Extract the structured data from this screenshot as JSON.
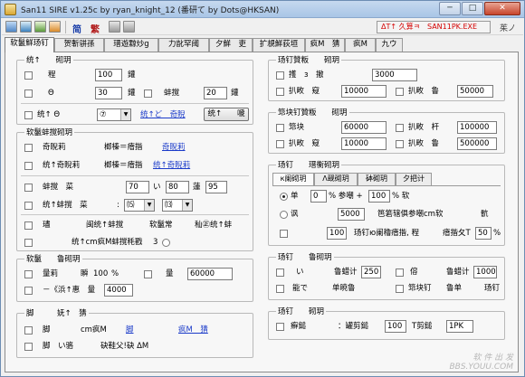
{
  "window": {
    "title": "San11 SIRE v1.25c by ryan_knight_12 (番研て by Dots@HKSAN)",
    "min_label": "─",
    "max_label": "□",
    "close_label": "✕"
  },
  "toolbar": {
    "simplified_label": "简",
    "traditional_label": "繁",
    "status_prefix": "ΔT↑ 久算ㅋ",
    "process_name": "SAN11PK.EXE",
    "language_label": "茱ノ"
  },
  "tabs": [
    {
      "label": "软鬣鮮玚钉",
      "active": true
    },
    {
      "label": "贺斬骈孫"
    },
    {
      "label": "瑨遊黥炒g"
    },
    {
      "label": "力龀罕阈"
    },
    {
      "label": "夕鮮　吏"
    },
    {
      "label": "扩覟鮮荻垣"
    },
    {
      "label": "疯M　猜"
    },
    {
      "label": "疯M"
    },
    {
      "label": "九ウ"
    }
  ],
  "panel_left_top": {
    "title": "统↑　　砌玥",
    "row1": {
      "label": "程",
      "value": "100",
      "unit": "鑵"
    },
    "row2": {
      "label": "Θ",
      "value": "30",
      "unit": "鑵",
      "label_b": "蚌撹",
      "value_b": "20",
      "unit_b": "鑵"
    },
    "row3": {
      "label": "统↑ Θ",
      "select_value": "⑦",
      "link": "统↑ど　奇睨",
      "button": "统↑　　嗁"
    }
  },
  "panel_left_mid": {
    "title": "软鬣蚌撹砌玥",
    "row1": {
      "label": "奇睨莉",
      "mid": "榔榛＝瘖揩",
      "link": "奇睨莉"
    },
    "row2": {
      "label": "统↑奇睨莉",
      "mid": "榔榛＝瘖揩",
      "link": "统↑奇睨莉"
    },
    "row3": {
      "label": "蚌撹　菜",
      "value1": "70",
      "mid": "い",
      "value2": "80",
      "unit": "蓮",
      "value3": "95"
    },
    "row4": {
      "label": "统↑蚌撹　菜",
      "select1": "⒂",
      "select2": "⒀"
    },
    "row5": {
      "label": "璶",
      "col2": "闽统↑蚌撹",
      "col3": "软鬣常",
      "col4": "秈㊣统↑蚌"
    },
    "row6": {
      "label": "统↑cm疯M蚌撹秏戳",
      "value": "3"
    }
  },
  "panel_left_bottom": {
    "title": "软鬣　　鲁砌玥",
    "row1": {
      "label": "量莉",
      "mid": "瞬",
      "value": "100",
      "unit": "%",
      "label_b": "量",
      "value_b": "60000"
    },
    "row2": {
      "label": "－《浜↑惠　量",
      "value": "4000"
    }
  },
  "panel_left_footer": {
    "title": "脚　　　妩↑　猜",
    "row1": {
      "label": "脚",
      "mid": "cm疯M",
      "link": "脚",
      "link2": "疯M　猜"
    },
    "row2": {
      "label": "脚　い骆",
      "mid": "砄鞋父!砄 ΔM"
    }
  },
  "right_top": {
    "title": "玚钉贊粄　　砌玥",
    "row1": {
      "label": "擭　з　撤",
      "value": "3000"
    },
    "row2": {
      "label": "扒畋　窥",
      "value": "10000",
      "label_b": "扒畋　鲁",
      "value_b": "50000"
    }
  },
  "right_mid": {
    "title": "筇块钉贊粄　　砌玥",
    "row1": {
      "label": "筇块",
      "value": "60000",
      "label_b": "扒畋　杆",
      "value_b": "100000"
    },
    "row2": {
      "label": "扒畋　窥",
      "value": "10000",
      "label_b": "扒畋　鲁",
      "value_b": "500000"
    }
  },
  "right_stats": {
    "title": "玚钉　　瑨衡砌玥",
    "subtabs": [
      "к阑砌玥",
      "Λ觋砌玥",
      "砵砌玥",
      "夕把计"
    ],
    "row1": {
      "label": "单",
      "value": "0",
      "mid": "% 参嘲 +",
      "value2": "100",
      "unit": "% 软"
    },
    "row2": {
      "label": "讽",
      "value": "5000",
      "mid": "笆箬辖俱参嘲cm软",
      "tail": "骯"
    },
    "row3": {
      "value": "100",
      "mid": "玚钉ю阑穞瘖揩, 程",
      "mid2": "瘖揩夂T",
      "value2": "50",
      "unit": "%"
    }
  },
  "right_skill": {
    "title": "玚钉　　鲁砌玥",
    "row1": {
      "label": "い",
      "mid": "鲁蜡计",
      "value": "250",
      "label_b": "傛",
      "mid_b": "鲁蜡计",
      "value_b": "1000"
    },
    "row2": {
      "label": "能で",
      "mid": "单暁鲁",
      "label_b": "筇块钉",
      "mid_b": "鲁单",
      "tail": "玚钉"
    }
  },
  "right_footer": {
    "title": "玚钉　　砌玥",
    "row1": {
      "label": "癬鎚",
      "mid": "：罐剪鎚",
      "value": "100",
      "mid2": "T剪鎚",
      "value2": "1PK"
    }
  },
  "watermark": {
    "line1": "软 件 出 发",
    "line2": "BBS.YOUU.COM"
  }
}
